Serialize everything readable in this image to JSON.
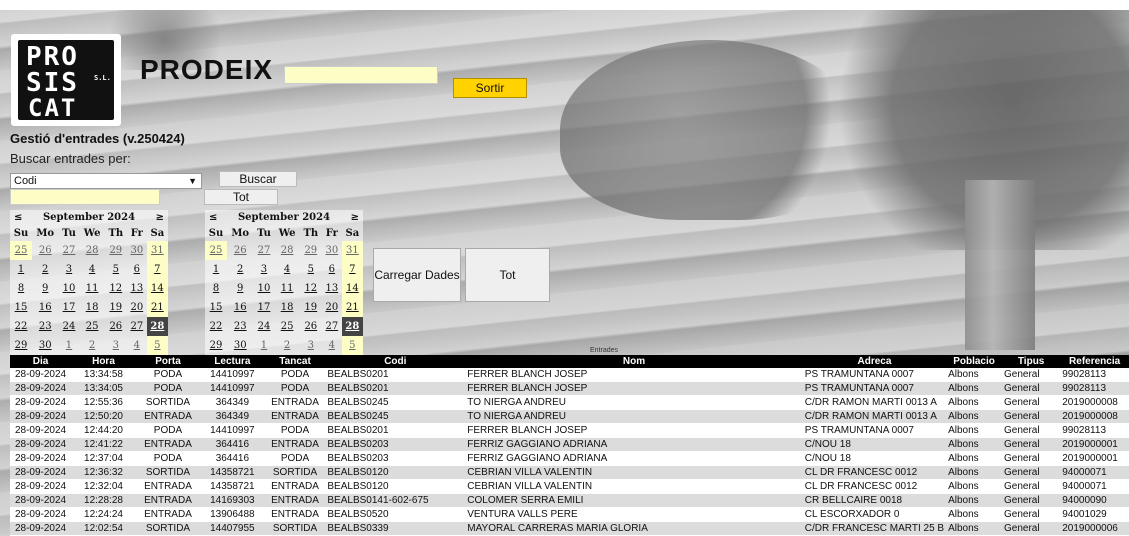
{
  "app": {
    "brand": "PRODEIX",
    "logo_lines": [
      "PRO",
      "SIS",
      "CAT"
    ],
    "logo_sl": "S.L.",
    "sortir_label": "Sortir"
  },
  "form": {
    "title": "Gestió d'entrades (v.250424)",
    "search_by_label": "Buscar entrades per:",
    "select_value": "Codi",
    "buscar_label": "Buscar",
    "tot_label": "Tot"
  },
  "calendars": [
    {
      "prev": "≤",
      "next": "≥",
      "month": "September 2024",
      "days": [
        "Su",
        "Mo",
        "Tu",
        "We",
        "Th",
        "Fr",
        "Sa"
      ],
      "weeks": [
        [
          "25",
          "26",
          "27",
          "28",
          "29",
          "30",
          "31"
        ],
        [
          "1",
          "2",
          "3",
          "4",
          "5",
          "6",
          "7"
        ],
        [
          "8",
          "9",
          "10",
          "11",
          "12",
          "13",
          "14"
        ],
        [
          "15",
          "16",
          "17",
          "18",
          "19",
          "20",
          "21"
        ],
        [
          "22",
          "23",
          "24",
          "25",
          "26",
          "27",
          "28"
        ],
        [
          "29",
          "30",
          "1",
          "2",
          "3",
          "4",
          "5"
        ]
      ]
    },
    {
      "prev": "≤",
      "next": "≥",
      "month": "September 2024",
      "days": [
        "Su",
        "Mo",
        "Tu",
        "We",
        "Th",
        "Fr",
        "Sa"
      ],
      "weeks": [
        [
          "25",
          "26",
          "27",
          "28",
          "29",
          "30",
          "31"
        ],
        [
          "1",
          "2",
          "3",
          "4",
          "5",
          "6",
          "7"
        ],
        [
          "8",
          "9",
          "10",
          "11",
          "12",
          "13",
          "14"
        ],
        [
          "15",
          "16",
          "17",
          "18",
          "19",
          "20",
          "21"
        ],
        [
          "22",
          "23",
          "24",
          "25",
          "26",
          "27",
          "28"
        ],
        [
          "29",
          "30",
          "1",
          "2",
          "3",
          "4",
          "5"
        ]
      ]
    }
  ],
  "actions": {
    "carregar_label": "Carregar Dades",
    "tot_label": "Tot"
  },
  "grid": {
    "caption": "Entrades",
    "columns": [
      "Dia",
      "Hora",
      "Porta",
      "Lectura",
      "Tancat",
      "Codi",
      "Nom",
      "Adreca",
      "Poblacio",
      "Tipus",
      "Referencia"
    ],
    "rows": [
      [
        "28-09-2024",
        "13:34:58",
        "PODA",
        "14410997",
        "PODA",
        "BEALBS0201",
        "FERRER BLANCH JOSEP",
        "PS TRAMUNTANA 0007",
        "Albons",
        "General",
        "99028113"
      ],
      [
        "28-09-2024",
        "13:34:05",
        "PODA",
        "14410997",
        "PODA",
        "BEALBS0201",
        "FERRER BLANCH JOSEP",
        "PS TRAMUNTANA 0007",
        "Albons",
        "General",
        "99028113"
      ],
      [
        "28-09-2024",
        "12:55:36",
        "SORTIDA",
        "364349",
        "ENTRADA",
        "BEALBS0245",
        "TO NIERGA ANDREU",
        "C/DR RAMON MARTI 0013 A",
        "Albons",
        "General",
        "2019000008"
      ],
      [
        "28-09-2024",
        "12:50:20",
        "ENTRADA",
        "364349",
        "ENTRADA",
        "BEALBS0245",
        "TO NIERGA ANDREU",
        "C/DR RAMON MARTI 0013 A",
        "Albons",
        "General",
        "2019000008"
      ],
      [
        "28-09-2024",
        "12:44:20",
        "PODA",
        "14410997",
        "PODA",
        "BEALBS0201",
        "FERRER BLANCH JOSEP",
        "PS TRAMUNTANA 0007",
        "Albons",
        "General",
        "99028113"
      ],
      [
        "28-09-2024",
        "12:41:22",
        "ENTRADA",
        "364416",
        "ENTRADA",
        "BEALBS0203",
        "FERRIZ GAGGIANO ADRIANA",
        "C/NOU 18",
        "Albons",
        "General",
        "2019000001"
      ],
      [
        "28-09-2024",
        "12:37:04",
        "PODA",
        "364416",
        "PODA",
        "BEALBS0203",
        "FERRIZ GAGGIANO ADRIANA",
        "C/NOU 18",
        "Albons",
        "General",
        "2019000001"
      ],
      [
        "28-09-2024",
        "12:36:32",
        "SORTIDA",
        "14358721",
        "SORTIDA",
        "BEALBS0120",
        "CEBRIAN VILLA VALENTIN",
        "CL DR FRANCESC 0012",
        "Albons",
        "General",
        "94000071"
      ],
      [
        "28-09-2024",
        "12:32:04",
        "ENTRADA",
        "14358721",
        "ENTRADA",
        "BEALBS0120",
        "CEBRIAN VILLA VALENTIN",
        "CL DR FRANCESC 0012",
        "Albons",
        "General",
        "94000071"
      ],
      [
        "28-09-2024",
        "12:28:28",
        "ENTRADA",
        "14169303",
        "ENTRADA",
        "BEALBS0141-602-675",
        "COLOMER SERRA EMILI",
        "CR BELLCAIRE 0018",
        "Albons",
        "General",
        "94000090"
      ],
      [
        "28-09-2024",
        "12:24:24",
        "ENTRADA",
        "13906488",
        "ENTRADA",
        "BEALBS0520",
        "VENTURA VALLS PERE",
        "CL ESCORXADOR 0",
        "Albons",
        "General",
        "94001029"
      ],
      [
        "28-09-2024",
        "12:02:54",
        "SORTIDA",
        "14407955",
        "SORTIDA",
        "BEALBS0339",
        "MAYORAL CARRERAS MARIA GLORIA",
        "C/DR FRANCESC MARTI 25 B",
        "Albons",
        "General",
        "2019000006"
      ]
    ]
  }
}
